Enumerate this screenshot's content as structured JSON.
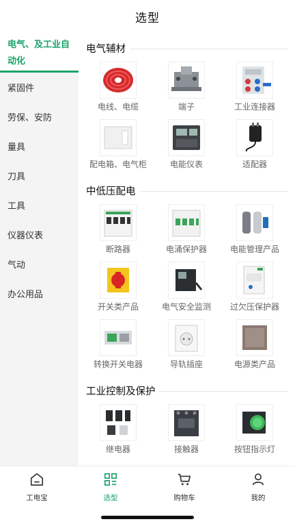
{
  "header": {
    "title": "选型"
  },
  "sidebar": {
    "items": [
      {
        "label": "电气、及工业自动化",
        "active": true
      },
      {
        "label": "紧固件"
      },
      {
        "label": "劳保、安防"
      },
      {
        "label": "量具"
      },
      {
        "label": "刀具"
      },
      {
        "label": "工具"
      },
      {
        "label": "仪器仪表"
      },
      {
        "label": "气动"
      },
      {
        "label": "办公用品"
      }
    ]
  },
  "sections": [
    {
      "title": "电气辅材",
      "items": [
        {
          "label": "电线、电缆",
          "icon": "cable-reel-icon"
        },
        {
          "label": "端子",
          "icon": "terminal-block-icon"
        },
        {
          "label": "工业连接器",
          "icon": "industrial-connector-icon"
        },
        {
          "label": "配电箱、电气柜",
          "icon": "distribution-box-icon"
        },
        {
          "label": "电能仪表",
          "icon": "energy-meter-icon"
        },
        {
          "label": "适配器",
          "icon": "adapter-icon"
        }
      ]
    },
    {
      "title": "中低压配电",
      "items": [
        {
          "label": "断路器",
          "icon": "circuit-breaker-icon"
        },
        {
          "label": "电涌保护器",
          "icon": "surge-protector-icon"
        },
        {
          "label": "电能管理产品",
          "icon": "power-management-icon"
        },
        {
          "label": "开关类产品",
          "icon": "switch-product-icon"
        },
        {
          "label": "电气安全监测",
          "icon": "safety-monitor-icon"
        },
        {
          "label": "过欠压保护器",
          "icon": "voltage-protector-icon"
        },
        {
          "label": "转换开关电器",
          "icon": "transfer-switch-icon"
        },
        {
          "label": "导轨插座",
          "icon": "rail-socket-icon"
        },
        {
          "label": "电源类产品",
          "icon": "power-supply-icon"
        }
      ]
    },
    {
      "title": "工业控制及保护",
      "items": [
        {
          "label": "继电器",
          "icon": "relay-icon"
        },
        {
          "label": "接触器",
          "icon": "contactor-icon"
        },
        {
          "label": "按钮指示灯",
          "icon": "push-button-icon"
        }
      ]
    }
  ],
  "tabbar": {
    "items": [
      {
        "label": "工电宝",
        "icon": "home-icon"
      },
      {
        "label": "选型",
        "icon": "grid-select-icon",
        "active": true
      },
      {
        "label": "购物车",
        "icon": "cart-icon"
      },
      {
        "label": "我的",
        "icon": "user-icon"
      }
    ]
  },
  "colors": {
    "accent": "#1aa36b",
    "sidebar_bg": "#f4f4f4",
    "label_gray": "#666666"
  }
}
